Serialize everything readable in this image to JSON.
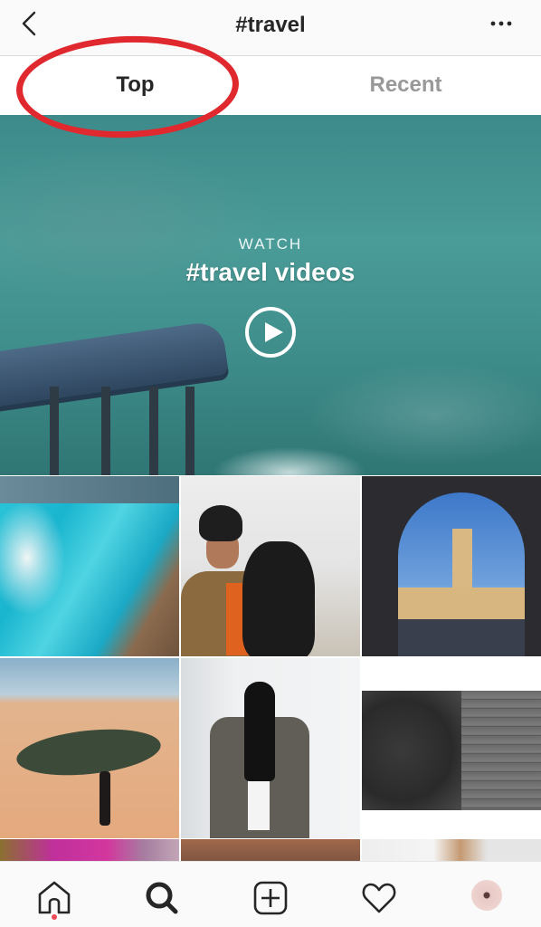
{
  "header": {
    "title": "#travel",
    "back_icon": "chevron-left-icon",
    "more_icon": "more-horizontal-icon"
  },
  "tabs": [
    {
      "label": "Top",
      "active": true
    },
    {
      "label": "Recent",
      "active": false
    }
  ],
  "annotation": {
    "color": "#e0282f",
    "target": "Top"
  },
  "video": {
    "label": "WATCH",
    "title": "#travel videos",
    "play_icon": "play-icon"
  },
  "grid": {
    "posts": [
      {
        "description": "Aerial turquoise lagoon with white sand swirls"
      },
      {
        "description": "Smiling man in beanie holding a black dog"
      },
      {
        "description": "Bell tower viewed through a stone archway"
      },
      {
        "description": "Desert oasis with person walking on sand dune"
      },
      {
        "description": "Woman in black beanie and grey coat"
      },
      {
        "description": "Black and white street scene on stone steps"
      },
      {
        "description": "Pink bougainvillea flowers"
      },
      {
        "description": "Warm-toned sunset photo"
      },
      {
        "description": "Portrait of blonde woman"
      }
    ]
  },
  "bottom_nav": {
    "items": [
      {
        "name": "home",
        "icon": "home-icon",
        "notification": true
      },
      {
        "name": "search",
        "icon": "search-icon",
        "active": true
      },
      {
        "name": "new-post",
        "icon": "plus-square-icon"
      },
      {
        "name": "activity",
        "icon": "heart-icon"
      },
      {
        "name": "profile",
        "icon": "avatar"
      }
    ]
  },
  "colors": {
    "header_bg": "#fafafa",
    "text_primary": "#262626",
    "text_inactive": "#999999",
    "notification_dot": "#ed4956"
  }
}
